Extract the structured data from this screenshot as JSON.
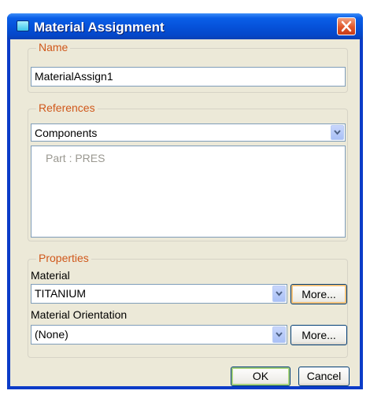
{
  "window": {
    "title": "Material Assignment"
  },
  "name_group": {
    "legend": "Name",
    "value": "MaterialAssign1"
  },
  "references_group": {
    "legend": "References",
    "type_selected": "Components",
    "items": [
      "Part : PRES"
    ]
  },
  "properties_group": {
    "legend": "Properties",
    "material_label": "Material",
    "material_value": "TITANIUM",
    "material_more": "More...",
    "orientation_label": "Material Orientation",
    "orientation_value": "(None)",
    "orientation_more": "More..."
  },
  "buttons": {
    "ok": "OK",
    "cancel": "Cancel"
  }
}
